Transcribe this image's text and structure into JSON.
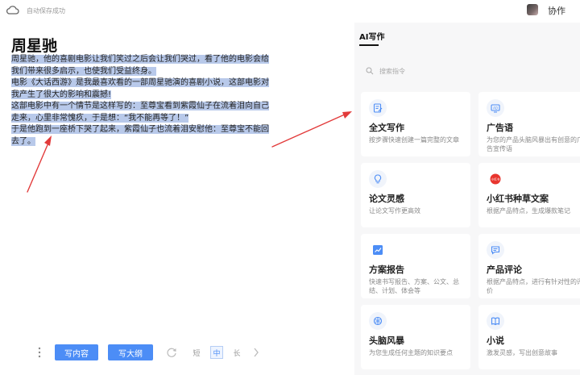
{
  "topbar": {
    "save_status": "自动保存成功",
    "collab_label": "协作"
  },
  "document": {
    "title": "周星驰",
    "paragraphs": [
      "周星驰，他的喜剧电影让我们笑过之后会让我们哭过，看了他的电影会给我们带来很多启示，也使我们受益终身。",
      "电影《大话西游》是我最喜欢看的一部周星驰演的喜剧小说，这部电影对我产生了很大的影响和震撼!",
      "这部电影中有一个情节是这样写的：至尊宝看到紫霞仙子在流着泪向自己走来，心里非常愧疚，于是想：“我不能再等了！”",
      "于是他跑到一座桥下哭了起来，紫霞仙子也流着泪安慰他：至尊宝不能回去了。"
    ]
  },
  "toolbar": {
    "write_label": "写内容",
    "outline_label": "写大纲",
    "short_label": "短",
    "mid_label": "中",
    "long_label": "长"
  },
  "ai_panel": {
    "tab_label": "AI写作",
    "search_placeholder": "搜索指令",
    "cards": [
      {
        "title": "全文写作",
        "desc": "按步骤快速创建一篇完整的文章",
        "icon": "edit-doc-icon"
      },
      {
        "title": "广告语",
        "desc": "为您的产品头脑风暴出有创意的广告宣传语",
        "icon": "ad-icon"
      },
      {
        "title": "论文灵感",
        "desc": "让论文写作更高效",
        "icon": "lightbulb-icon"
      },
      {
        "title": "小红书种草文案",
        "desc": "根据产品特点，生成爆款笔记",
        "icon": "xiaohongshu-icon"
      },
      {
        "title": "方案报告",
        "desc": "快速书写报告、方案、公文、总结、计划、体会等",
        "icon": "report-icon"
      },
      {
        "title": "产品评论",
        "desc": "根据产品特点，进行有针对性的评价",
        "icon": "comment-icon"
      },
      {
        "title": "头脑风暴",
        "desc": "为您生成任何主题的知识要点",
        "icon": "brain-icon"
      },
      {
        "title": "小说",
        "desc": "激发灵感，写出创意故事",
        "icon": "book-icon"
      }
    ]
  },
  "colors": {
    "accent": "#4c8df6",
    "selection": "#b8c9ea",
    "annotation": "#e23b3b",
    "panel_bg": "#f7f7f8"
  }
}
